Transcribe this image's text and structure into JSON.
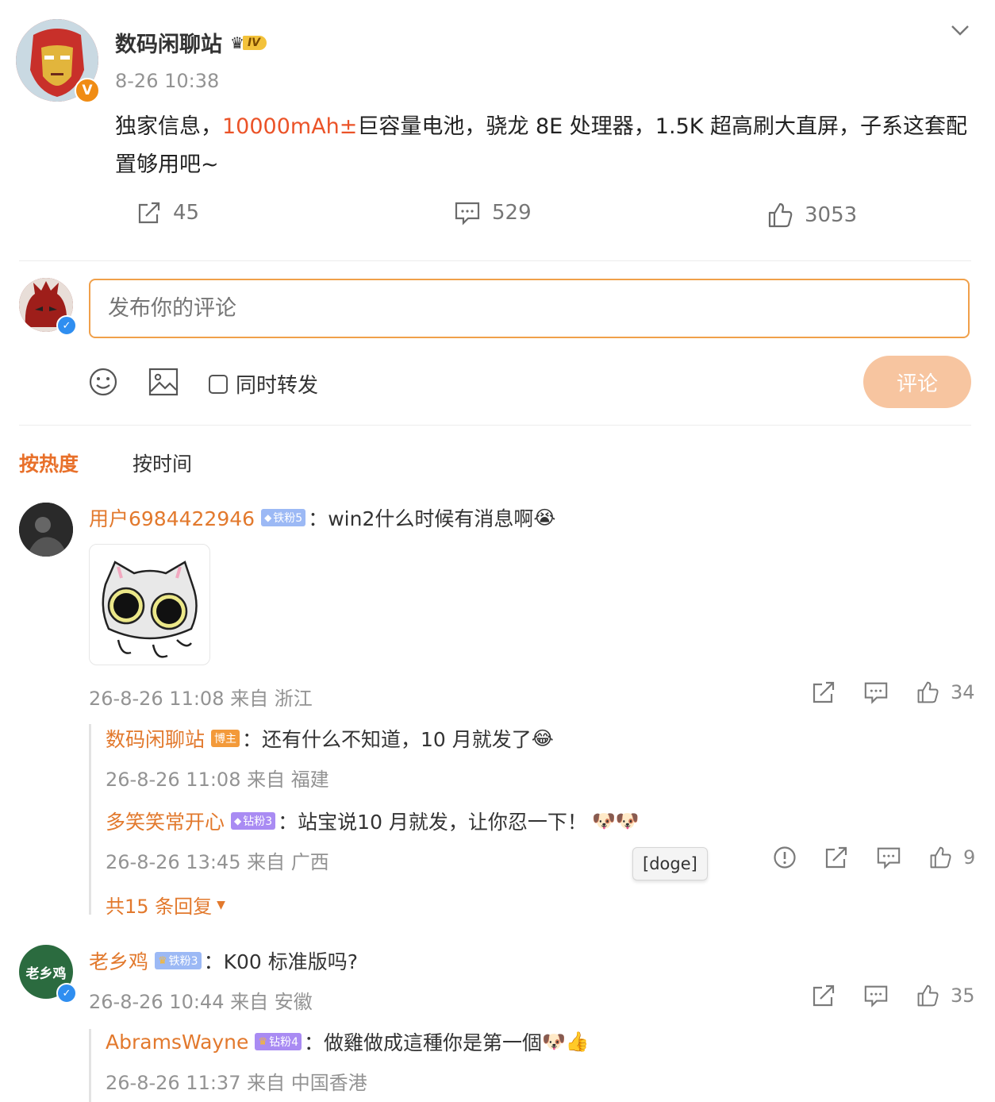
{
  "post": {
    "author": "数码闲聊站",
    "level_badge": "IV",
    "time": "8-26 10:38",
    "text_before": "独家信息，",
    "text_highlight": "10000mAh±",
    "text_after": "巨容量电池，骁龙 8E 处理器，1.5K 超高刷大直屏，子系这套配置够用吧~",
    "reposts": "45",
    "comments": "529",
    "likes": "3053"
  },
  "composer": {
    "placeholder": "发布你的评论",
    "sync_label": "同时转发",
    "submit_label": "评论"
  },
  "sort_tabs": {
    "hot": "按热度",
    "time": "按时间"
  },
  "comments": [
    {
      "user": "用户6984422946",
      "badge": "铁粉5",
      "text": "：win2什么时候有消息啊",
      "meta": "26-8-26 11:08 来自 浙江",
      "likes": "34",
      "replies": [
        {
          "user": "数码闲聊站",
          "badge": "博主",
          "text": "：还有什么不知道，10 月就发了",
          "meta": "26-8-26 11:08 来自 福建"
        },
        {
          "user": "多笑笑常开心",
          "badge": "钻粉3",
          "text": "：站宝说10 月就发，让你忍一下！",
          "meta": "26-8-26 13:45 来自 广西",
          "likes": "9",
          "tooltip": "[doge]"
        }
      ],
      "more_replies": "共15 条回复"
    },
    {
      "user": "老乡鸡",
      "avatar_text": "老乡鸡",
      "badge": "铁粉3",
      "text": "：K00 标准版吗?",
      "meta": "26-8-26 10:44 来自 安徽",
      "likes": "35",
      "replies": [
        {
          "user": "AbramsWayne",
          "badge": "钻粉4",
          "text": "：做雞做成這種你是第一個",
          "meta": "26-8-26 11:37 来自 中国香港"
        }
      ]
    }
  ]
}
